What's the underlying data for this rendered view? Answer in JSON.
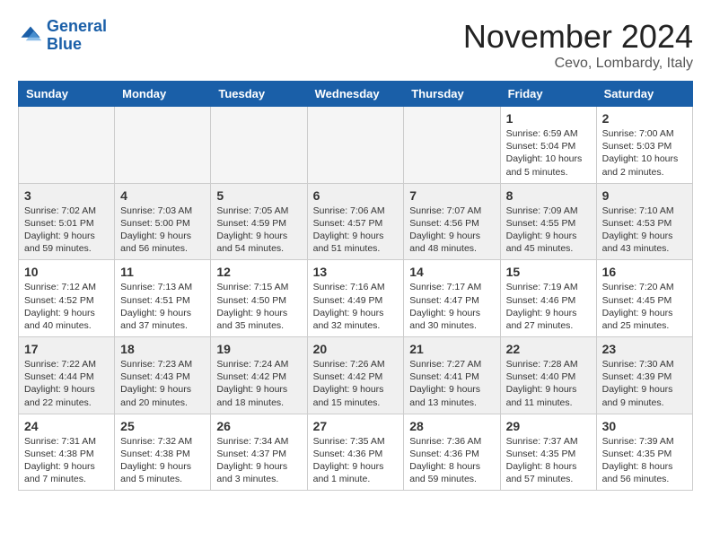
{
  "logo": {
    "line1": "General",
    "line2": "Blue"
  },
  "title": "November 2024",
  "location": "Cevo, Lombardy, Italy",
  "weekdays": [
    "Sunday",
    "Monday",
    "Tuesday",
    "Wednesday",
    "Thursday",
    "Friday",
    "Saturday"
  ],
  "weeks": [
    [
      {
        "day": "",
        "info": ""
      },
      {
        "day": "",
        "info": ""
      },
      {
        "day": "",
        "info": ""
      },
      {
        "day": "",
        "info": ""
      },
      {
        "day": "",
        "info": ""
      },
      {
        "day": "1",
        "info": "Sunrise: 6:59 AM\nSunset: 5:04 PM\nDaylight: 10 hours\nand 5 minutes."
      },
      {
        "day": "2",
        "info": "Sunrise: 7:00 AM\nSunset: 5:03 PM\nDaylight: 10 hours\nand 2 minutes."
      }
    ],
    [
      {
        "day": "3",
        "info": "Sunrise: 7:02 AM\nSunset: 5:01 PM\nDaylight: 9 hours\nand 59 minutes."
      },
      {
        "day": "4",
        "info": "Sunrise: 7:03 AM\nSunset: 5:00 PM\nDaylight: 9 hours\nand 56 minutes."
      },
      {
        "day": "5",
        "info": "Sunrise: 7:05 AM\nSunset: 4:59 PM\nDaylight: 9 hours\nand 54 minutes."
      },
      {
        "day": "6",
        "info": "Sunrise: 7:06 AM\nSunset: 4:57 PM\nDaylight: 9 hours\nand 51 minutes."
      },
      {
        "day": "7",
        "info": "Sunrise: 7:07 AM\nSunset: 4:56 PM\nDaylight: 9 hours\nand 48 minutes."
      },
      {
        "day": "8",
        "info": "Sunrise: 7:09 AM\nSunset: 4:55 PM\nDaylight: 9 hours\nand 45 minutes."
      },
      {
        "day": "9",
        "info": "Sunrise: 7:10 AM\nSunset: 4:53 PM\nDaylight: 9 hours\nand 43 minutes."
      }
    ],
    [
      {
        "day": "10",
        "info": "Sunrise: 7:12 AM\nSunset: 4:52 PM\nDaylight: 9 hours\nand 40 minutes."
      },
      {
        "day": "11",
        "info": "Sunrise: 7:13 AM\nSunset: 4:51 PM\nDaylight: 9 hours\nand 37 minutes."
      },
      {
        "day": "12",
        "info": "Sunrise: 7:15 AM\nSunset: 4:50 PM\nDaylight: 9 hours\nand 35 minutes."
      },
      {
        "day": "13",
        "info": "Sunrise: 7:16 AM\nSunset: 4:49 PM\nDaylight: 9 hours\nand 32 minutes."
      },
      {
        "day": "14",
        "info": "Sunrise: 7:17 AM\nSunset: 4:47 PM\nDaylight: 9 hours\nand 30 minutes."
      },
      {
        "day": "15",
        "info": "Sunrise: 7:19 AM\nSunset: 4:46 PM\nDaylight: 9 hours\nand 27 minutes."
      },
      {
        "day": "16",
        "info": "Sunrise: 7:20 AM\nSunset: 4:45 PM\nDaylight: 9 hours\nand 25 minutes."
      }
    ],
    [
      {
        "day": "17",
        "info": "Sunrise: 7:22 AM\nSunset: 4:44 PM\nDaylight: 9 hours\nand 22 minutes."
      },
      {
        "day": "18",
        "info": "Sunrise: 7:23 AM\nSunset: 4:43 PM\nDaylight: 9 hours\nand 20 minutes."
      },
      {
        "day": "19",
        "info": "Sunrise: 7:24 AM\nSunset: 4:42 PM\nDaylight: 9 hours\nand 18 minutes."
      },
      {
        "day": "20",
        "info": "Sunrise: 7:26 AM\nSunset: 4:42 PM\nDaylight: 9 hours\nand 15 minutes."
      },
      {
        "day": "21",
        "info": "Sunrise: 7:27 AM\nSunset: 4:41 PM\nDaylight: 9 hours\nand 13 minutes."
      },
      {
        "day": "22",
        "info": "Sunrise: 7:28 AM\nSunset: 4:40 PM\nDaylight: 9 hours\nand 11 minutes."
      },
      {
        "day": "23",
        "info": "Sunrise: 7:30 AM\nSunset: 4:39 PM\nDaylight: 9 hours\nand 9 minutes."
      }
    ],
    [
      {
        "day": "24",
        "info": "Sunrise: 7:31 AM\nSunset: 4:38 PM\nDaylight: 9 hours\nand 7 minutes."
      },
      {
        "day": "25",
        "info": "Sunrise: 7:32 AM\nSunset: 4:38 PM\nDaylight: 9 hours\nand 5 minutes."
      },
      {
        "day": "26",
        "info": "Sunrise: 7:34 AM\nSunset: 4:37 PM\nDaylight: 9 hours\nand 3 minutes."
      },
      {
        "day": "27",
        "info": "Sunrise: 7:35 AM\nSunset: 4:36 PM\nDaylight: 9 hours\nand 1 minute."
      },
      {
        "day": "28",
        "info": "Sunrise: 7:36 AM\nSunset: 4:36 PM\nDaylight: 8 hours\nand 59 minutes."
      },
      {
        "day": "29",
        "info": "Sunrise: 7:37 AM\nSunset: 4:35 PM\nDaylight: 8 hours\nand 57 minutes."
      },
      {
        "day": "30",
        "info": "Sunrise: 7:39 AM\nSunset: 4:35 PM\nDaylight: 8 hours\nand 56 minutes."
      }
    ]
  ]
}
